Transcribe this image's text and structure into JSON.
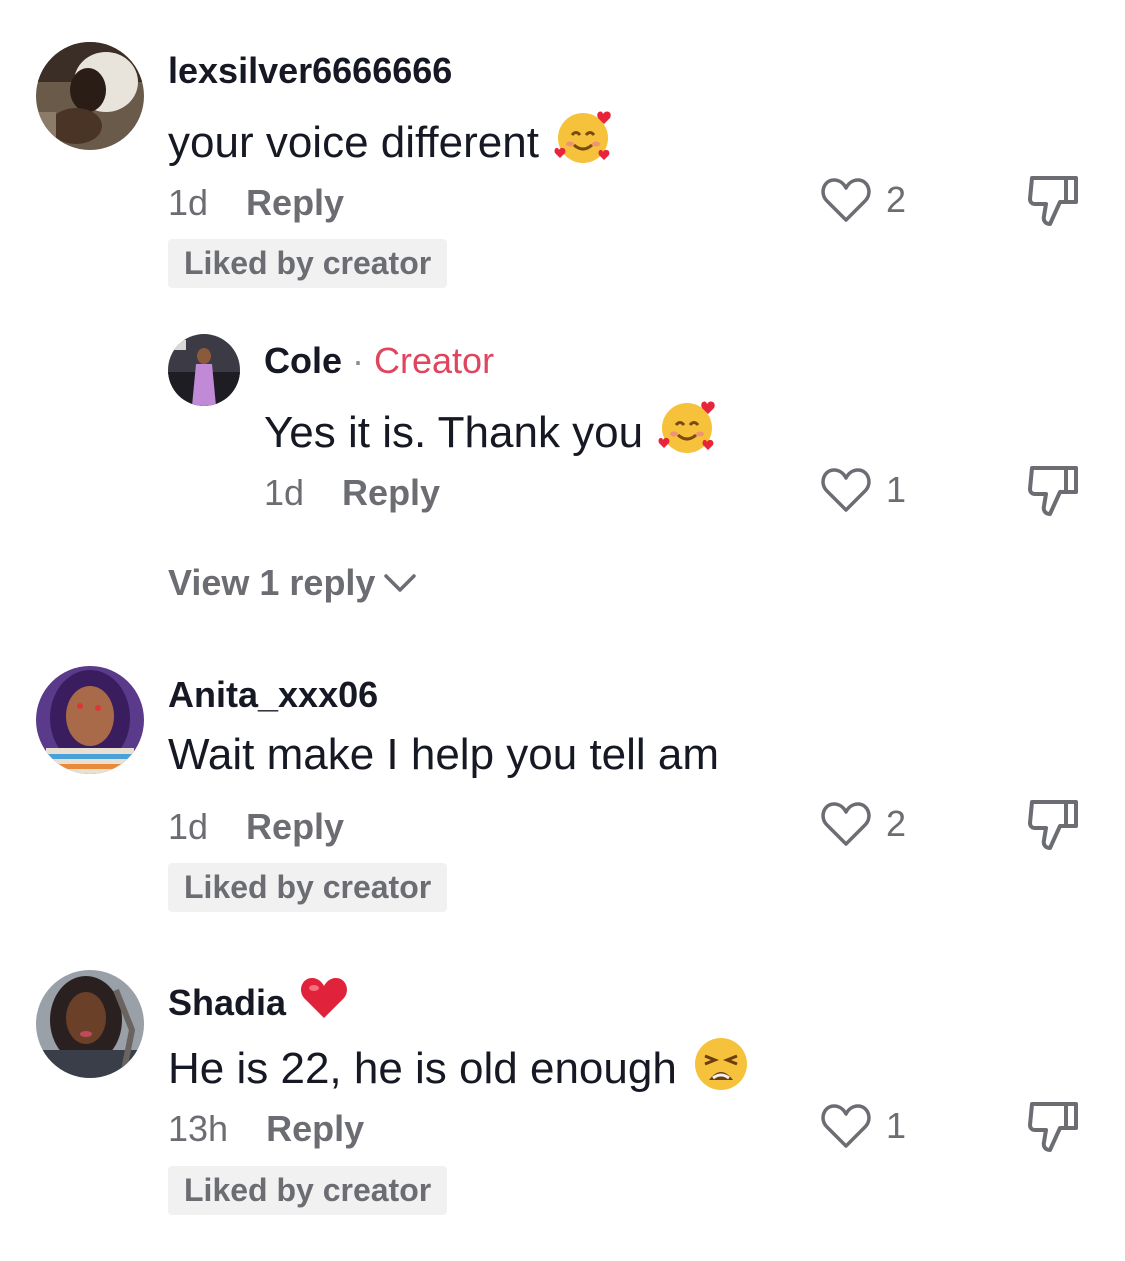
{
  "comments": [
    {
      "username": "lexsilver6666666",
      "text": "your voice different",
      "emoji_icon": "smiling-face-with-hearts",
      "time": "1d",
      "reply_label": "Reply",
      "likes": "2",
      "badge": "Liked by creator",
      "reply": {
        "username": "Cole",
        "separator": "·",
        "creator_label": "Creator",
        "text": "Yes it is. Thank you",
        "emoji_icon": "smiling-face-with-hearts",
        "time": "1d",
        "reply_label": "Reply",
        "likes": "1"
      },
      "view_replies": "View 1 reply"
    },
    {
      "username": "Anita_xxx06",
      "text": "Wait make I help you tell am",
      "time": "1d",
      "reply_label": "Reply",
      "likes": "2",
      "badge": "Liked by creator"
    },
    {
      "username": "Shadia",
      "username_emoji_icon": "red-heart",
      "text": "He is 22, he is old enough",
      "emoji_icon": "weary-face",
      "time": "13h",
      "reply_label": "Reply",
      "likes": "1",
      "badge": "Liked by creator"
    }
  ],
  "icons": {
    "like": "heart-outline-icon",
    "dislike": "thumbs-down-icon",
    "expand": "chevron-down-icon"
  },
  "colors": {
    "text": "#161823",
    "secondary": "#6c6d73",
    "creator": "#e0455e",
    "badge_bg": "#f1f1f2"
  }
}
